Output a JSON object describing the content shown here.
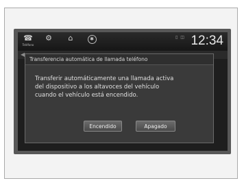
{
  "statusbar": {
    "items": [
      {
        "label": "Teléfono",
        "icon": "phone-icon",
        "glyph": "☎"
      },
      {
        "label": "",
        "icon": "hfl-icon",
        "glyph": "⚙"
      },
      {
        "label": "",
        "icon": "fm-icon",
        "glyph": "⌂"
      },
      {
        "label": "",
        "icon": "settings-icon",
        "glyph": "✱"
      }
    ],
    "status_icons": "▯ ◫",
    "clock": "12:34"
  },
  "dialog": {
    "title": "Transferencia automática de llamada teléfono",
    "body_lines": [
      "Transferir automáticamente una llamada activa",
      "del dispositivo a los altavoces del vehículo",
      "cuando el vehículo está encendido."
    ],
    "buttons": {
      "on": "Encendido",
      "off": "Apagado"
    }
  },
  "colors": {
    "screen_bg": "#1e1e1e",
    "dialog_bg": "#3a3a3a",
    "text": "#e0e0e0"
  }
}
